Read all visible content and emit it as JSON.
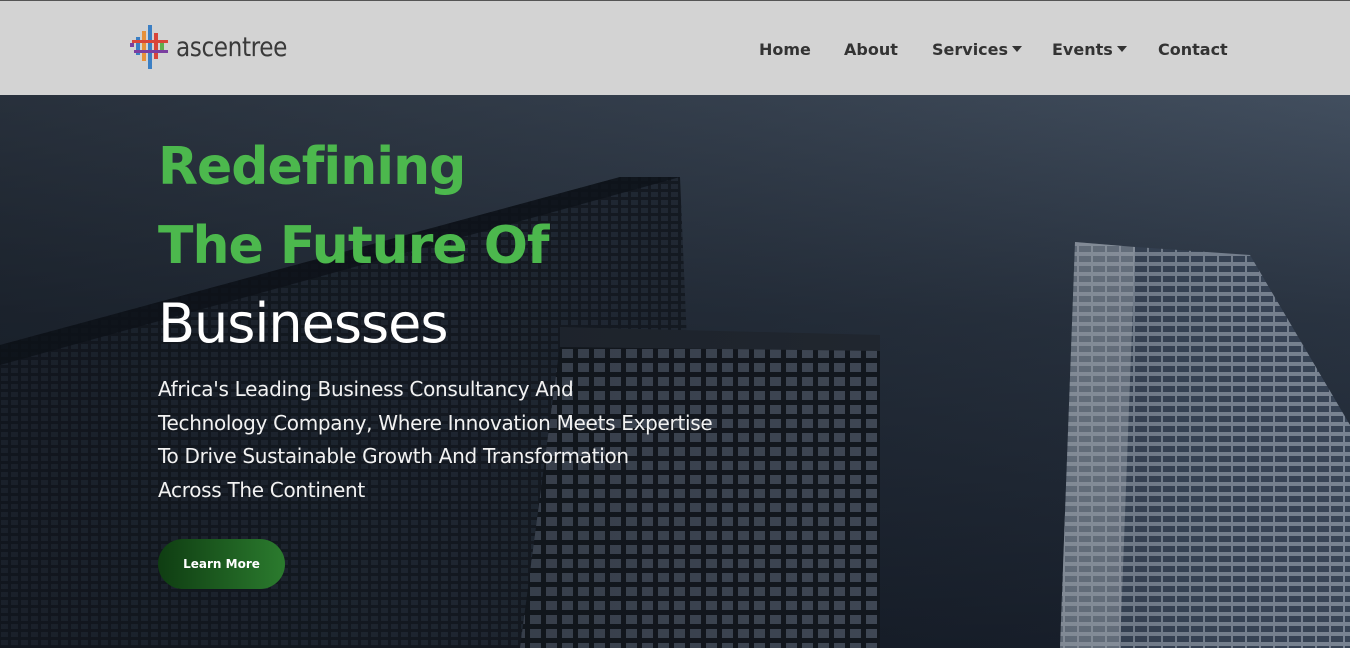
{
  "brand": {
    "name": "ascentree"
  },
  "nav": {
    "items": [
      {
        "label": "Home",
        "has_dropdown": false
      },
      {
        "label": "About",
        "has_dropdown": false
      },
      {
        "label": "Services",
        "has_dropdown": true
      },
      {
        "label": "Events",
        "has_dropdown": true
      },
      {
        "label": "Contact",
        "has_dropdown": false
      }
    ]
  },
  "hero": {
    "heading_line1": "Redefining",
    "heading_line2": "The Future Of",
    "heading_line3": "Businesses",
    "lead_lines": [
      "Africa's Leading Business Consultancy And",
      "Technology Company, Where Innovation Meets Expertise",
      "To Drive Sustainable Growth And Transformation",
      "Across The Continent"
    ],
    "cta_label": "Learn More"
  },
  "colors": {
    "accent_green": "#4cb84d",
    "topbar_bg": "#d3d3d3",
    "cta_dark": "#0f3d12",
    "cta_light": "#2b7b2e"
  },
  "icons": {
    "logo": "ascentree-logo-icon",
    "dropdown": "caret-down-icon"
  }
}
